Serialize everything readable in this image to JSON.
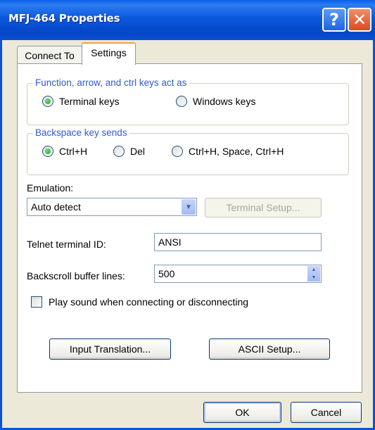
{
  "window": {
    "title": "MFJ-464 Properties",
    "help_glyph": "?",
    "close_glyph": "✕"
  },
  "tabs": [
    {
      "label": "Connect To",
      "active": false
    },
    {
      "label": "Settings",
      "active": true
    }
  ],
  "function_keys_group": {
    "title": "Function, arrow, and ctrl keys act as",
    "options": [
      {
        "label": "Terminal keys",
        "checked": true
      },
      {
        "label": "Windows keys",
        "checked": false
      }
    ]
  },
  "backspace_group": {
    "title": "Backspace key sends",
    "options": [
      {
        "label": "Ctrl+H",
        "checked": true
      },
      {
        "label": "Del",
        "checked": false
      },
      {
        "label": "Ctrl+H, Space, Ctrl+H",
        "checked": false
      }
    ]
  },
  "emulation": {
    "label": "Emulation:",
    "value": "Auto detect",
    "setup_button": "Terminal Setup..."
  },
  "telnet": {
    "label": "Telnet terminal ID:",
    "value": "ANSI"
  },
  "backscroll": {
    "label": "Backscroll buffer lines:",
    "value": "500"
  },
  "sound": {
    "label": "Play sound when connecting or disconnecting",
    "checked": false
  },
  "buttons": {
    "input_translation": "Input Translation...",
    "ascii_setup": "ASCII Setup..."
  },
  "dialog_buttons": {
    "ok": "OK",
    "cancel": "Cancel"
  },
  "colors": {
    "title_bar": "#0A5FE8",
    "group_title": "#2F5AD4",
    "radio_checked": "#21A121",
    "close_button": "#DC4A1E"
  }
}
